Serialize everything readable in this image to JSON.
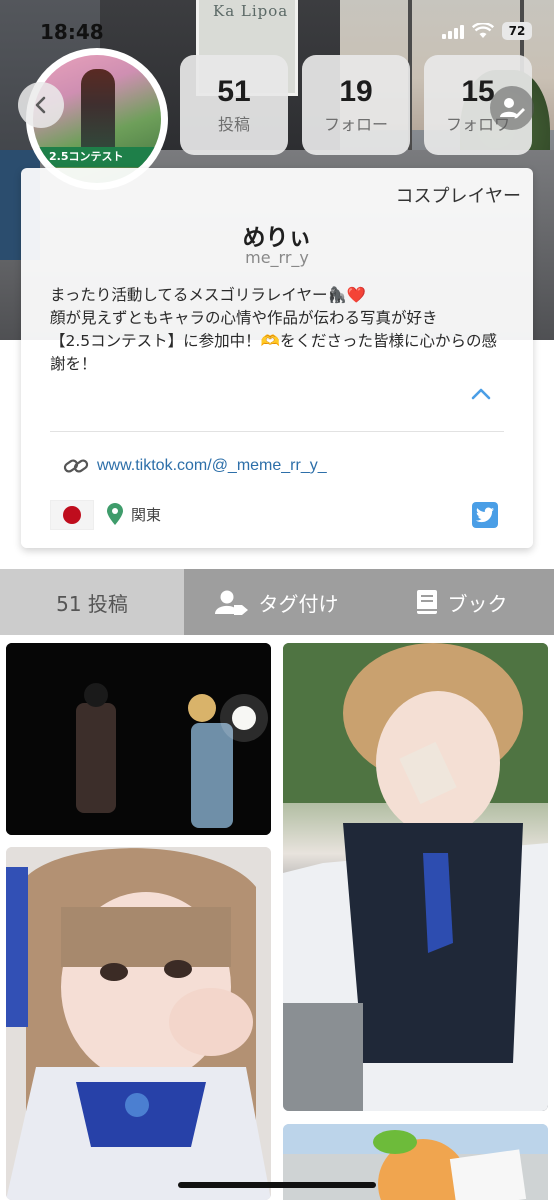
{
  "status_bar": {
    "time": "18:48",
    "battery": "72"
  },
  "header": {
    "sign_text": "Ka Lipoa",
    "avatar_banner": "2.5コンテスト"
  },
  "stats": [
    {
      "value": "51",
      "label": "投稿"
    },
    {
      "value": "19",
      "label": "フォロー"
    },
    {
      "value": "15",
      "label": "フォロワ"
    }
  ],
  "profile": {
    "category": "コスプレイヤー",
    "name": "めりぃ",
    "handle": "me_rr_y",
    "bio_lines": [
      "まったり活動してるメスゴリラレイヤー🦍❤️",
      "顔が見えずともキャラの心情や作品が伝わる写真が好き",
      "【2.5コンテスト】に参加中！🫶をくださった皆様に心からの感",
      "謝を！"
    ],
    "link": "www.tiktok.com/@_meme_rr_y_",
    "location": "関東"
  },
  "tabs": [
    {
      "label": "51 投稿",
      "icon": "grid-none"
    },
    {
      "label": "タグ付け",
      "icon": "tag-person-icon"
    },
    {
      "label": "ブック",
      "icon": "book-icon"
    }
  ],
  "colors": {
    "accent": "#4a9ee6",
    "link": "#2d6fa9",
    "tab_active": "#cccccc",
    "tab_inactive": "#9e9e9e"
  }
}
